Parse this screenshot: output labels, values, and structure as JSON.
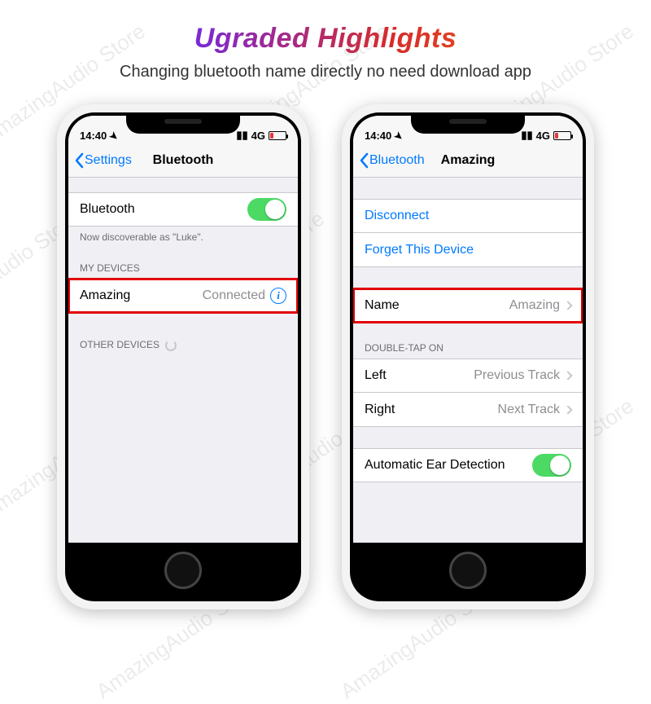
{
  "watermark": "AmazingAudio Store",
  "heading": "Ugraded Highlights",
  "subtitle": "Changing bluetooth name directly no need download app",
  "status": {
    "time": "14:40",
    "network": "4G"
  },
  "phone1": {
    "back_label": "Settings",
    "title": "Bluetooth",
    "bt_row_label": "Bluetooth",
    "discoverable_note": "Now discoverable as \"Luke\".",
    "my_devices_header": "MY DEVICES",
    "device_name": "Amazing",
    "device_status": "Connected",
    "other_devices_header": "OTHER DEVICES"
  },
  "phone2": {
    "back_label": "Bluetooth",
    "title": "Amazing",
    "disconnect": "Disconnect",
    "forget": "Forget This Device",
    "name_label": "Name",
    "name_value": "Amazing",
    "double_tap_header": "DOUBLE-TAP ON",
    "left_label": "Left",
    "left_value": "Previous Track",
    "right_label": "Right",
    "right_value": "Next Track",
    "auto_ear": "Automatic Ear Detection"
  }
}
